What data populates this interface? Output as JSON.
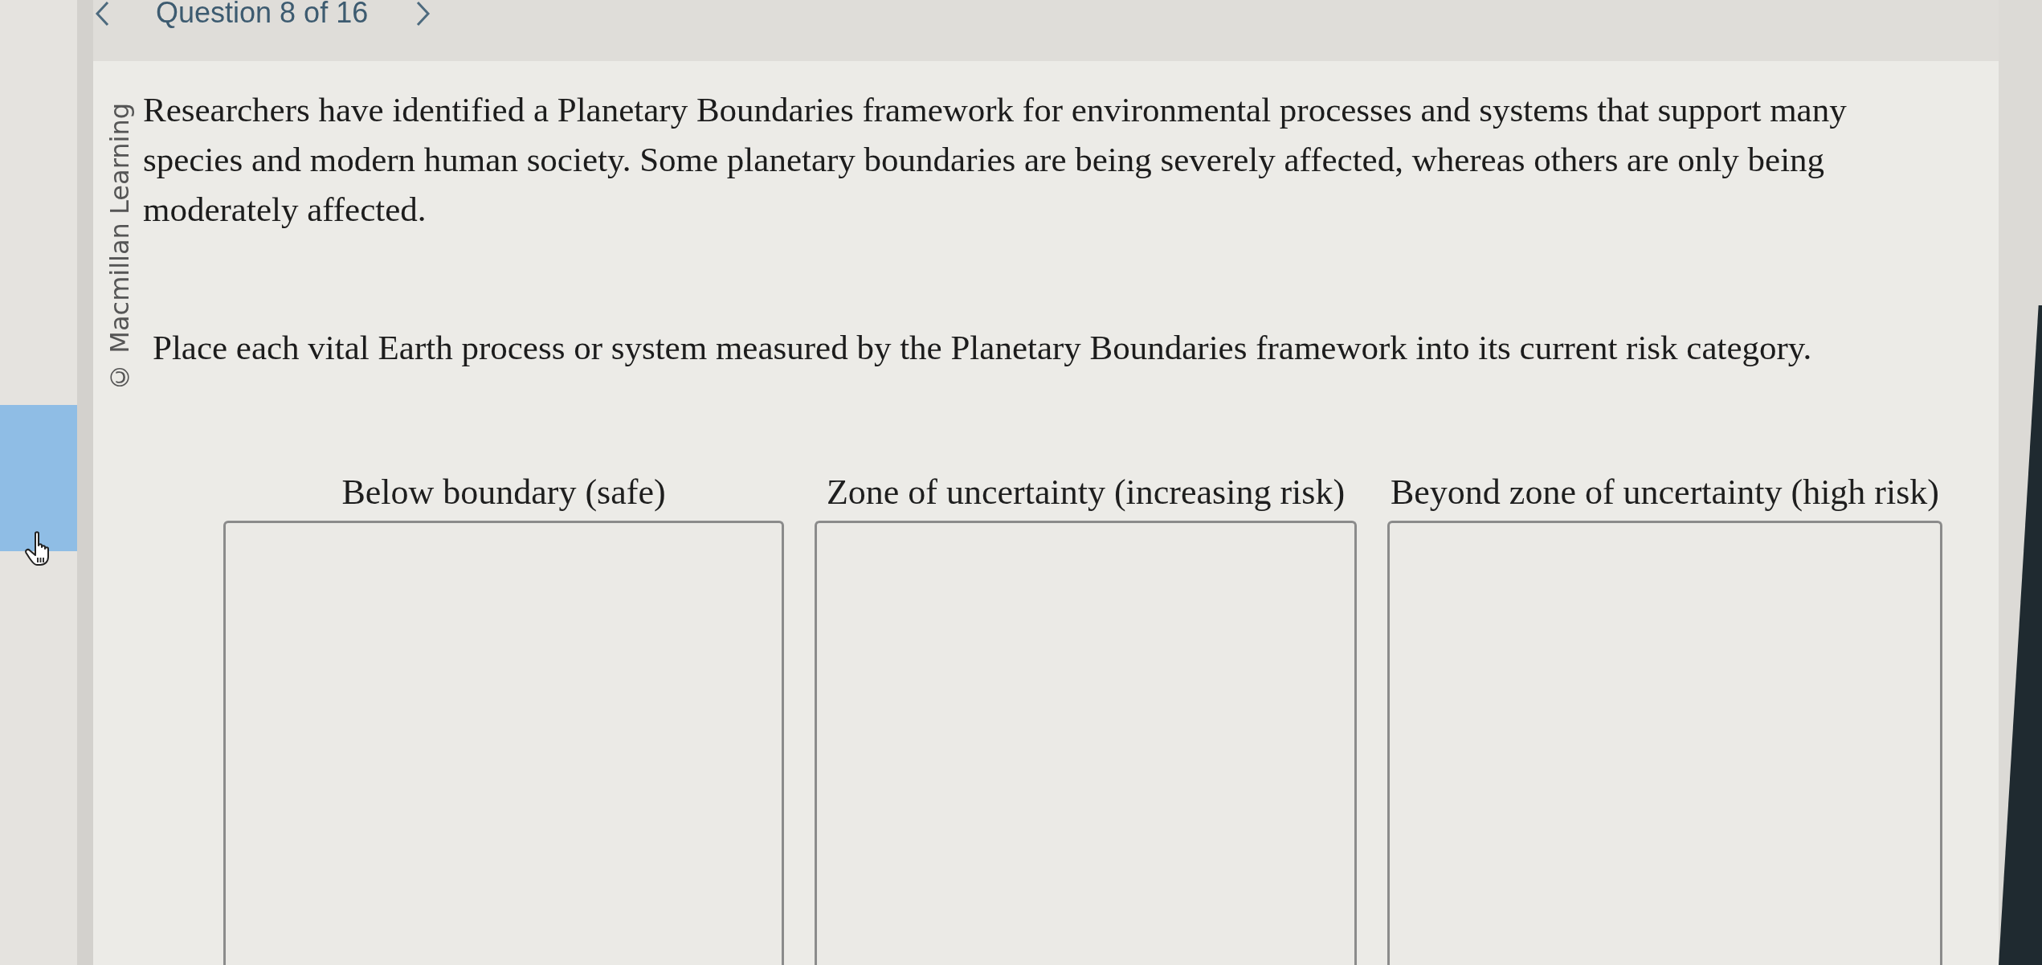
{
  "navigation": {
    "title": "Question 8 of 16"
  },
  "sidebar": {
    "items": [
      {
        "selected": true
      }
    ]
  },
  "copyright": "© Macmillan Learning",
  "question": {
    "paragraphs": [
      "Researchers have identified a Planetary Boundaries framework for environmental processes and systems that support many species and modern human society. Some planetary boundaries are being severely affected, whereas others are only being moderately affected.",
      "Place each vital Earth process or system measured by the Planetary Boundaries framework into its current risk category."
    ]
  },
  "categories": [
    {
      "label": "Below boundary (safe)"
    },
    {
      "label": "Zone of uncertainty (increasing risk)"
    },
    {
      "label": "Beyond zone of uncertainty (high risk)"
    }
  ]
}
